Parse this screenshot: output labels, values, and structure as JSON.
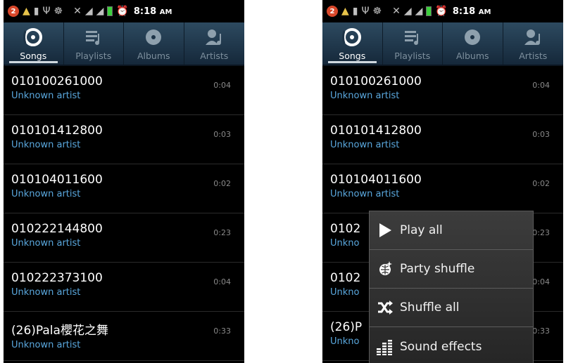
{
  "status_bar": {
    "notification_count": "2",
    "time": "8:18",
    "ampm": "AM",
    "icons": [
      "notification-badge-icon",
      "warning-icon",
      "sim-icon",
      "usb-icon",
      "debug-icon",
      "muted-icon",
      "signal-1-icon",
      "signal-2-icon",
      "battery-icon",
      "alarm-icon"
    ]
  },
  "tabs": [
    {
      "label": "Songs",
      "icon": "songs-icon",
      "active": true
    },
    {
      "label": "Playlists",
      "icon": "playlists-icon",
      "active": false
    },
    {
      "label": "Albums",
      "icon": "albums-icon",
      "active": false
    },
    {
      "label": "Artists",
      "icon": "artists-icon",
      "active": false
    }
  ],
  "songs": [
    {
      "title": "010100261000",
      "artist": "Unknown artist",
      "duration": "0:04"
    },
    {
      "title": "010101412800",
      "artist": "Unknown artist",
      "duration": "0:03"
    },
    {
      "title": "010104011600",
      "artist": "Unknown artist",
      "duration": "0:02"
    },
    {
      "title": "010222144800",
      "artist": "Unknown artist",
      "duration": "0:23"
    },
    {
      "title": "010222373100",
      "artist": "Unknown artist",
      "duration": "0:04"
    },
    {
      "title": "(26)Pala櫻花之舞",
      "artist": "Unknown artist",
      "duration": "0:33"
    }
  ],
  "right_songs_truncated": [
    {
      "title": "0102",
      "artist": "Unkno"
    },
    {
      "title": "0102",
      "artist": "Unkno"
    },
    {
      "title": "(26)P",
      "artist": "Unkno"
    }
  ],
  "context_menu": [
    {
      "label": "Play all",
      "icon": "play-icon"
    },
    {
      "label": "Party shuffle",
      "icon": "party-shuffle-icon"
    },
    {
      "label": "Shuffle all",
      "icon": "shuffle-icon"
    },
    {
      "label": "Sound effects",
      "icon": "equalizer-icon"
    }
  ],
  "colors": {
    "tab_bar": "#2d4a60",
    "artist_text": "#5aa8de",
    "menu_bg": "#333333"
  }
}
